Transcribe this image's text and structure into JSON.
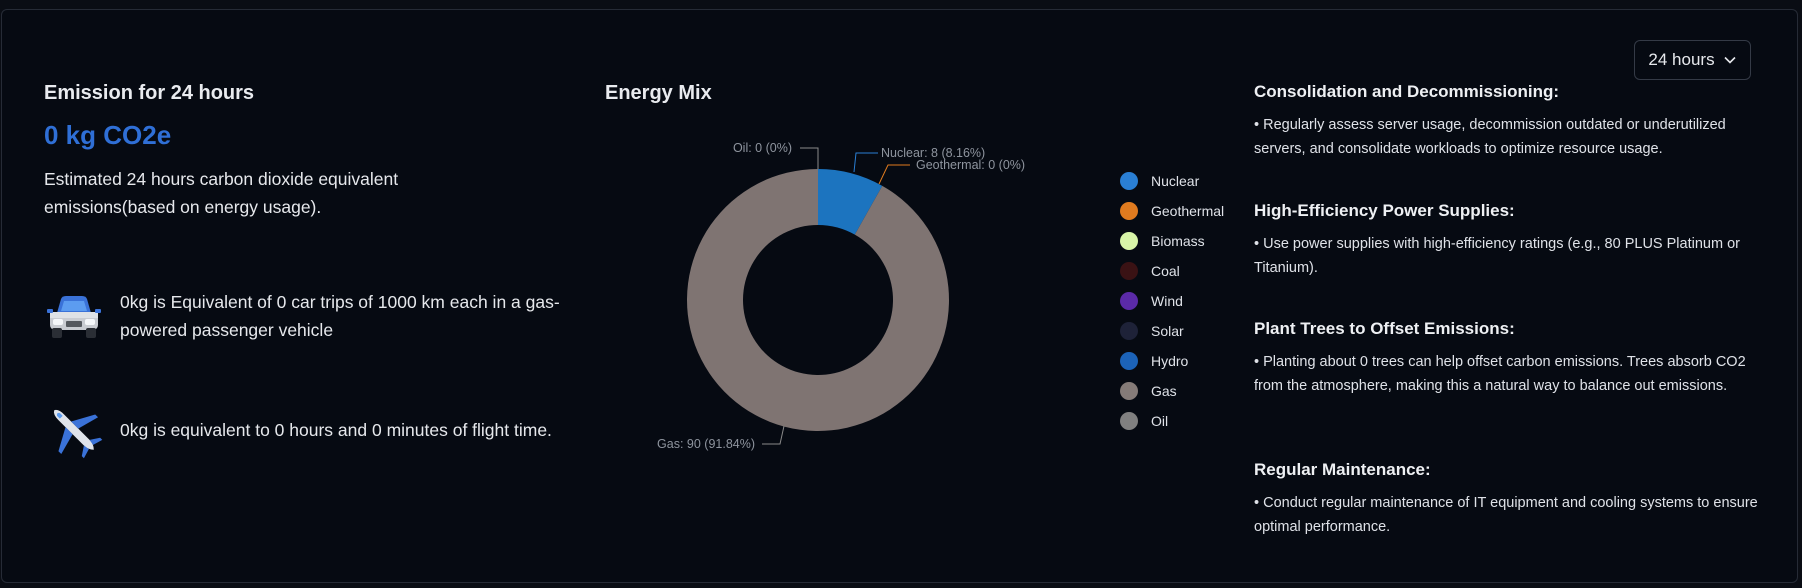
{
  "range_select": {
    "label": "24 hours"
  },
  "emission": {
    "title": "Emission for 24 hours",
    "value": "0 kg CO2e",
    "description": "Estimated 24 hours carbon dioxide equivalent emissions(based on energy usage).",
    "car_text": "0kg is Equivalent of 0 car trips of 1000 km each in a gas-powered passenger vehicle",
    "plane_text": "0kg is equivalent to 0 hours and 0 minutes of flight time.",
    "car_icon": "car-icon",
    "plane_icon": "airplane-icon"
  },
  "energy_mix": {
    "title": "Energy Mix",
    "callouts": {
      "oil": "Oil: 0 (0%)",
      "nuclear": "Nuclear: 8 (8.16%)",
      "geothermal": "Geothermal: 0 (0%)",
      "gas": "Gas: 90 (91.84%)"
    },
    "legend": [
      {
        "name": "Nuclear",
        "color": "#2a7fd4"
      },
      {
        "name": "Geothermal",
        "color": "#e07b1f"
      },
      {
        "name": "Biomass",
        "color": "#d8f5a8"
      },
      {
        "name": "Coal",
        "color": "#3a1214"
      },
      {
        "name": "Wind",
        "color": "#5b2aa8"
      },
      {
        "name": "Solar",
        "color": "#1e2238"
      },
      {
        "name": "Hydro",
        "color": "#1c63b8"
      },
      {
        "name": "Gas",
        "color": "#857b78"
      },
      {
        "name": "Oil",
        "color": "#808080"
      }
    ]
  },
  "chart_data": {
    "type": "pie",
    "title": "Energy Mix",
    "categories": [
      "Nuclear",
      "Geothermal",
      "Biomass",
      "Coal",
      "Wind",
      "Solar",
      "Hydro",
      "Gas",
      "Oil"
    ],
    "values": [
      8,
      0,
      0,
      0,
      0,
      0,
      0,
      90,
      0
    ],
    "percentages": [
      8.16,
      0,
      0,
      0,
      0,
      0,
      0,
      91.84,
      0
    ],
    "colors": [
      "#1c74bf",
      "#e07b1f",
      "#d8f5a8",
      "#3a1214",
      "#5b2aa8",
      "#1e2238",
      "#1c63b8",
      "#7f7472",
      "#808080"
    ],
    "legend_position": "right"
  },
  "tips": [
    {
      "title": "Consolidation and Decommissioning:",
      "text": "• Regularly assess server usage, decommission outdated or underutilized servers, and consolidate workloads to optimize resource usage."
    },
    {
      "title": "High-Efficiency Power Supplies:",
      "text": "• Use power supplies with high-efficiency ratings (e.g., 80 PLUS Platinum or Titanium)."
    },
    {
      "title": "Plant Trees to Offset Emissions:",
      "text": "• Planting about 0 trees can help offset carbon emissions. Trees absorb CO2 from the atmosphere, making this a natural way to balance out emissions."
    },
    {
      "title": "Regular Maintenance:",
      "text": "• Conduct regular maintenance of IT equipment and cooling systems to ensure optimal performance."
    }
  ]
}
